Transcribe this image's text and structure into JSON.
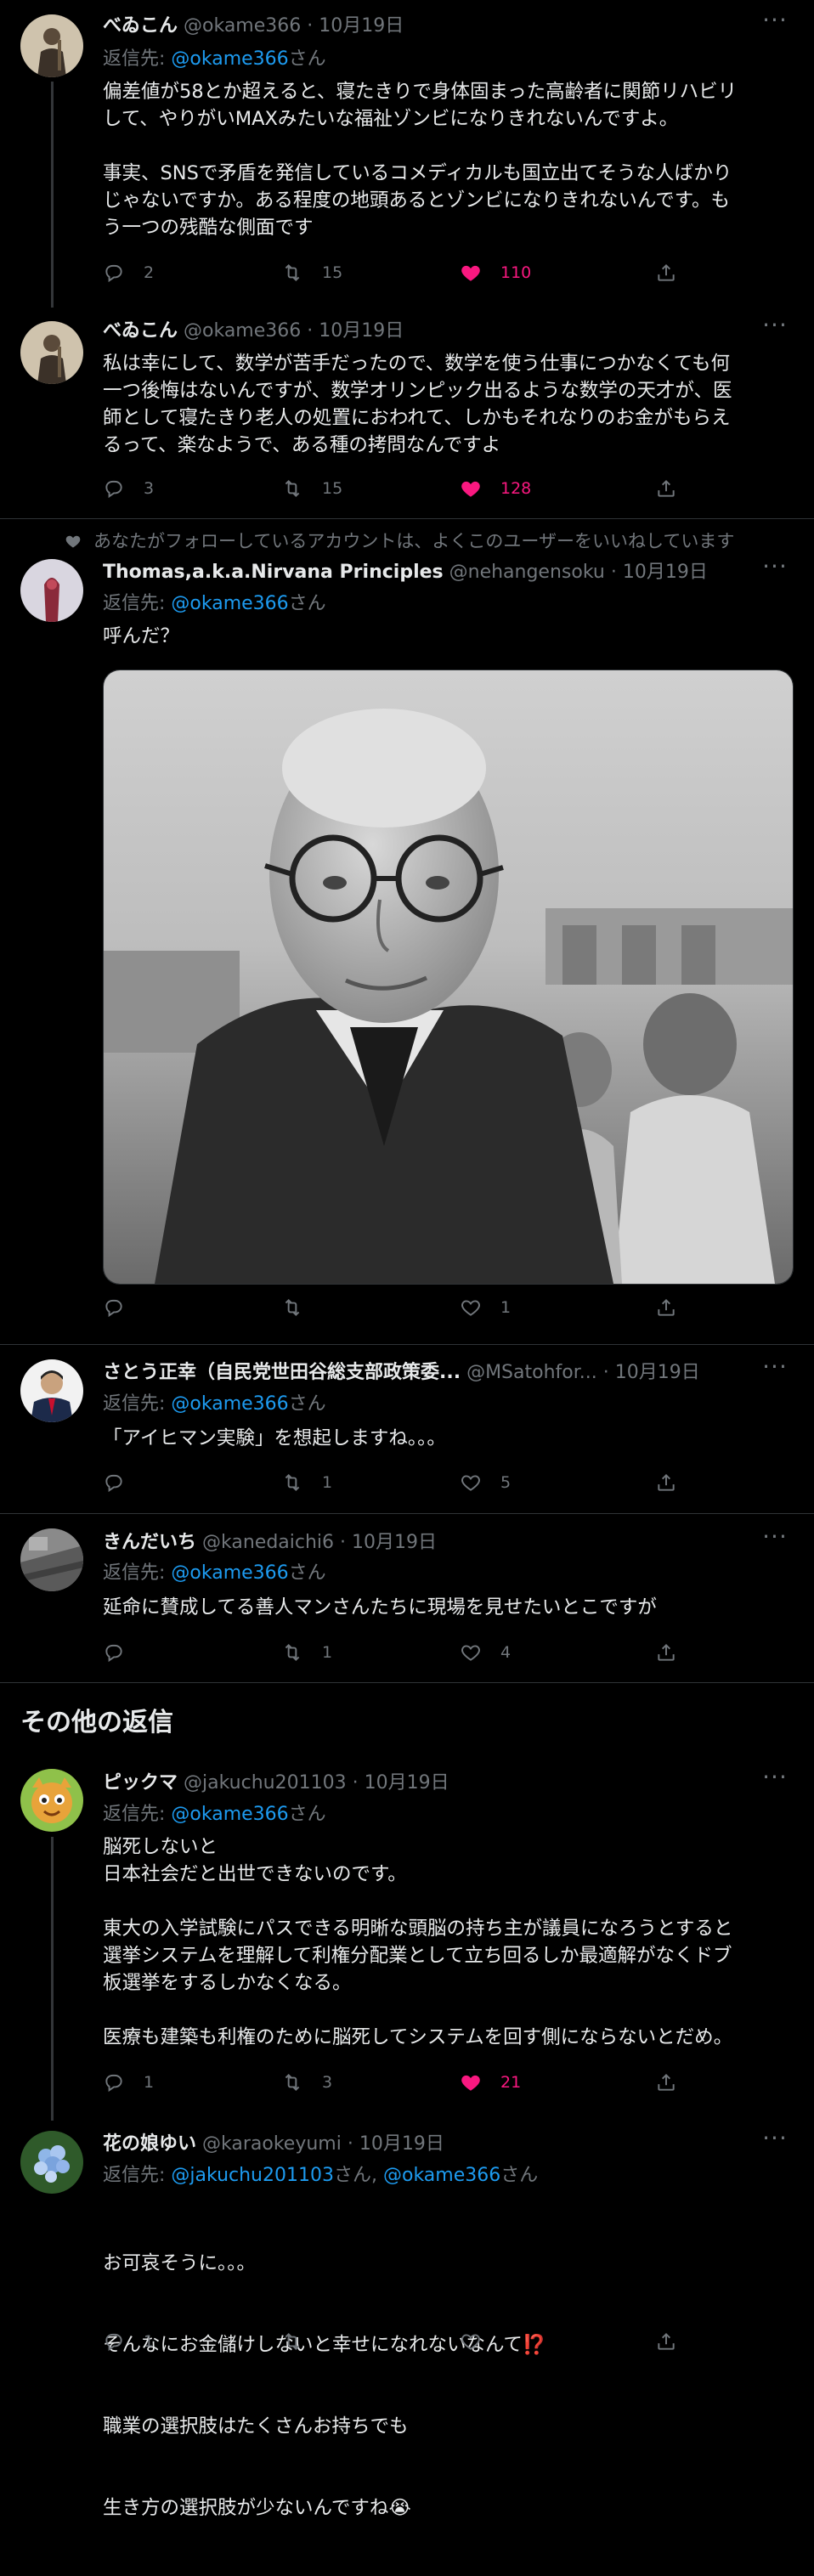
{
  "tweets": [
    {
      "name": "べゐこん",
      "handle": "@okame366",
      "dot": "·",
      "date": "10月19日",
      "reply_prefix": "返信先: ",
      "reply_link": "@okame366",
      "reply_suffix": "さん",
      "body": "偏差値が58とか超えると、寝たきりで身体固まった高齢者に関節リハビリ\nして、やりがいMAXみたいな福祉ゾンビになりきれないんですよ。\n\n事実、SNSで矛盾を発信しているコメディカルも国立出てそうな人ばかり\nじゃないですか。ある程度の地頭あるとゾンビになりきれないんです。も\nう一つの残酷な側面です",
      "replies": "2",
      "retweets": "15",
      "likes": "110",
      "liked": true
    },
    {
      "name": "べゐこん",
      "handle": "@okame366",
      "dot": "·",
      "date": "10月19日",
      "body": "私は幸にして、数学が苦手だったので、数学を使う仕事につかなくても何\n一つ後悔はないんですが、数学オリンピック出るような数学の天才が、医\n師として寝たきり老人の処置におわれて、しかもそれなりのお金がもらえ\nるって、楽なようで、ある種の拷問なんですよ",
      "replies": "3",
      "retweets": "15",
      "likes": "128",
      "liked": true
    },
    {
      "social_context": "あなたがフォローしているアカウントは、よくこのユーザーをいいねしています",
      "name": "Thomas,a.k.a.Nirvana Principles",
      "handle": "@nehangensoku",
      "dot": "·",
      "date": "10月19日",
      "reply_prefix": "返信先: ",
      "reply_link": "@okame366",
      "reply_suffix": "さん",
      "body": "呼んだ？",
      "replies": "",
      "retweets": "",
      "likes": "1",
      "liked": false
    },
    {
      "name": "さとう正幸（自民党世田谷総支部政策委...",
      "handle": "@MSatohfor...",
      "dot": "·",
      "date": "10月19日",
      "reply_prefix": "返信先: ",
      "reply_link": "@okame366",
      "reply_suffix": "さん",
      "body": "「アイヒマン実験」を想起しますね。。。",
      "replies": "",
      "retweets": "1",
      "likes": "5",
      "liked": false
    },
    {
      "name": "きんだいち",
      "handle": "@kanedaichi6",
      "dot": "·",
      "date": "10月19日",
      "reply_prefix": "返信先: ",
      "reply_link": "@okame366",
      "reply_suffix": "さん",
      "body": "延命に賛成してる善人マンさんたちに現場を見せたいとこですが",
      "replies": "",
      "retweets": "1",
      "likes": "4",
      "liked": false
    },
    {
      "name": "ピックマ",
      "handle": "@jakuchu201103",
      "dot": "·",
      "date": "10月19日",
      "reply_prefix": "返信先: ",
      "reply_link": "@okame366",
      "reply_suffix": "さん",
      "body": "脳死しないと\n日本社会だと出世できないのです。\n\n東大の入学試験にパスできる明晰な頭脳の持ち主が議員になろうとすると\n選挙システムを理解して利権分配業として立ち回るしか最適解がなくドブ\n板選挙をするしかなくなる。\n\n医療も建築も利権のために脳死してシステムを回す側にならないとだめ。",
      "replies": "1",
      "retweets": "3",
      "likes": "21",
      "liked": true
    },
    {
      "name": "花の娘ゆい",
      "handle": "@karaokeyumi",
      "dot": "·",
      "date": "10月19日",
      "reply_prefix": "返信先: ",
      "reply_link": "@jakuchu201103",
      "reply_mid": "さん, ",
      "reply_link2": "@okame366",
      "reply_suffix": "さん",
      "body_lines": [
        "お可哀そうに。。。",
        "そんなにお金儲けしないと幸せになれないなんて",
        "職業の選択肢はたくさんお持ちでも",
        "生き方の選択肢が少ないんですね"
      ],
      "body_emoji1": "⁉️",
      "body_emoji2": "😭",
      "replies": "1",
      "retweets": "",
      "likes": "",
      "liked": false
    }
  ],
  "section": {
    "more_replies_title": "その他の返信"
  },
  "icons": {
    "reply": "reply-icon",
    "retweet": "retweet-icon",
    "like": "heart-icon",
    "share": "share-icon",
    "more": "more-icon"
  },
  "colors": {
    "link": "#1d9bf0",
    "like": "#f91880",
    "muted": "#71767b",
    "text": "#e7e9ea",
    "bg": "#000000"
  }
}
